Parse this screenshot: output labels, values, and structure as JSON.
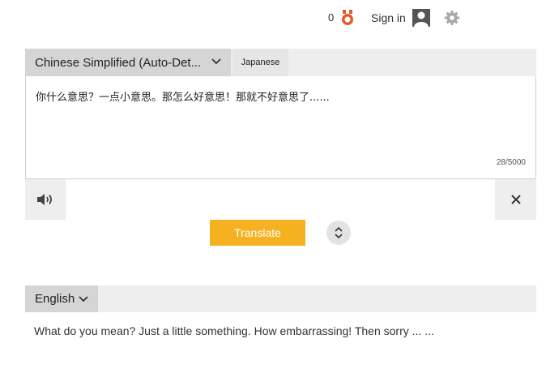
{
  "topbar": {
    "reward_count": "0",
    "medal_icon": "medal-icon",
    "signin_label": "Sign in",
    "avatar_icon": "user-avatar-icon",
    "settings_icon": "gear-icon"
  },
  "source": {
    "language": "Chinese Simplified (Auto-Det...",
    "alt_language": "Japanese",
    "text": "你什么意思？一点小意思。那怎么好意思！那就不好意思了......",
    "char_count": "28/5000"
  },
  "actions": {
    "speaker_icon": "speaker-icon",
    "clear_icon": "close-icon",
    "translate_label": "Translate",
    "swap_icon": "swap-icon"
  },
  "target": {
    "language": "English",
    "text": "What do you mean? Just a little something. How embarrassing! Then sorry ... ..."
  },
  "colors": {
    "accent": "#f5b120",
    "medal": "#e55a2b",
    "panel": "#eeeeee",
    "selected_tab": "#d5d5d5"
  }
}
